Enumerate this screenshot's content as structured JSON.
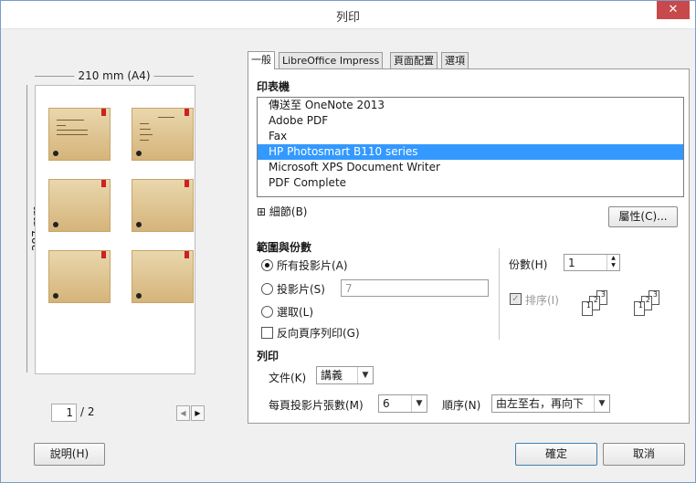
{
  "window": {
    "title": "列印",
    "close_label": "✕"
  },
  "preview": {
    "width_label": "210 mm (A4)",
    "height_label": "297 mm",
    "current_page": "1",
    "total_pages": "/ 2",
    "prev_glyph": "◀",
    "next_glyph": "▶"
  },
  "tabs": [
    "一般",
    "LibreOffice Impress",
    "頁面配置",
    "選項"
  ],
  "printer": {
    "section_title": "印表機",
    "list": [
      "傳送至 OneNote 2013",
      "Adobe PDF",
      "Fax",
      "HP Photosmart B110 series",
      "Microsoft XPS Document Writer",
      "PDF Complete"
    ],
    "selected": "HP Photosmart B110 series",
    "details_label": "細節(B)",
    "details_glyph": "⊞",
    "properties_button": "屬性(C)..."
  },
  "range": {
    "section_title": "範圍與份數",
    "all_slides": "所有投影片(A)",
    "slides": "投影片(S)",
    "slides_value": "7",
    "selection": "選取(L)",
    "reverse": "反向頁序列印(G)",
    "copies_label": "份數(H)",
    "copies_value": "1",
    "collate_label": "排序(I)",
    "collate_checked": true
  },
  "print": {
    "section_title": "列印",
    "document_label": "文件(K)",
    "document_value": "講義",
    "slides_per_page_label": "每頁投影片張數(M)",
    "slides_per_page_value": "6",
    "order_label": "順序(N)",
    "order_value": "由左至右，再向下"
  },
  "buttons": {
    "help": "說明(H)",
    "ok": "確定",
    "cancel": "取消"
  }
}
